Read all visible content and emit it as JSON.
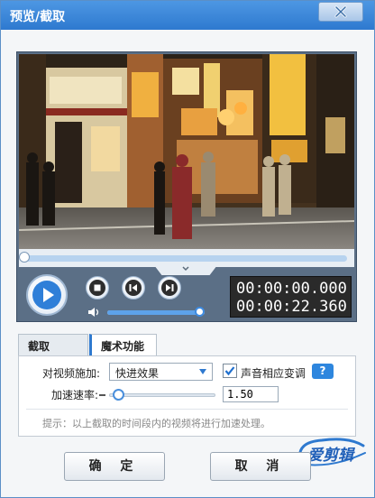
{
  "window": {
    "title": "预览/截取"
  },
  "player": {
    "time_current": "00:00:00.000",
    "time_total": "00:00:22.360",
    "progress": 0.0,
    "volume": 0.95
  },
  "tabs": [
    {
      "label": "截取",
      "active": false
    },
    {
      "label": "魔术功能",
      "active": true
    }
  ],
  "magic": {
    "effect_label": "对视频施加:",
    "effect_value": "快进效果",
    "pitch_label": "声音相应变调",
    "pitch_checked": true,
    "help_label": "?",
    "speed_label": "加速速率:",
    "speed_value": "1.50",
    "hint": "提示：以上截取的时间段内的视频将进行加速处理。"
  },
  "logo": {
    "text": "爱剪辑"
  },
  "buttons": {
    "ok": "确 定",
    "cancel": "取 消"
  },
  "colors": {
    "accent": "#2e79cf",
    "title_bar": "#3d88da"
  }
}
